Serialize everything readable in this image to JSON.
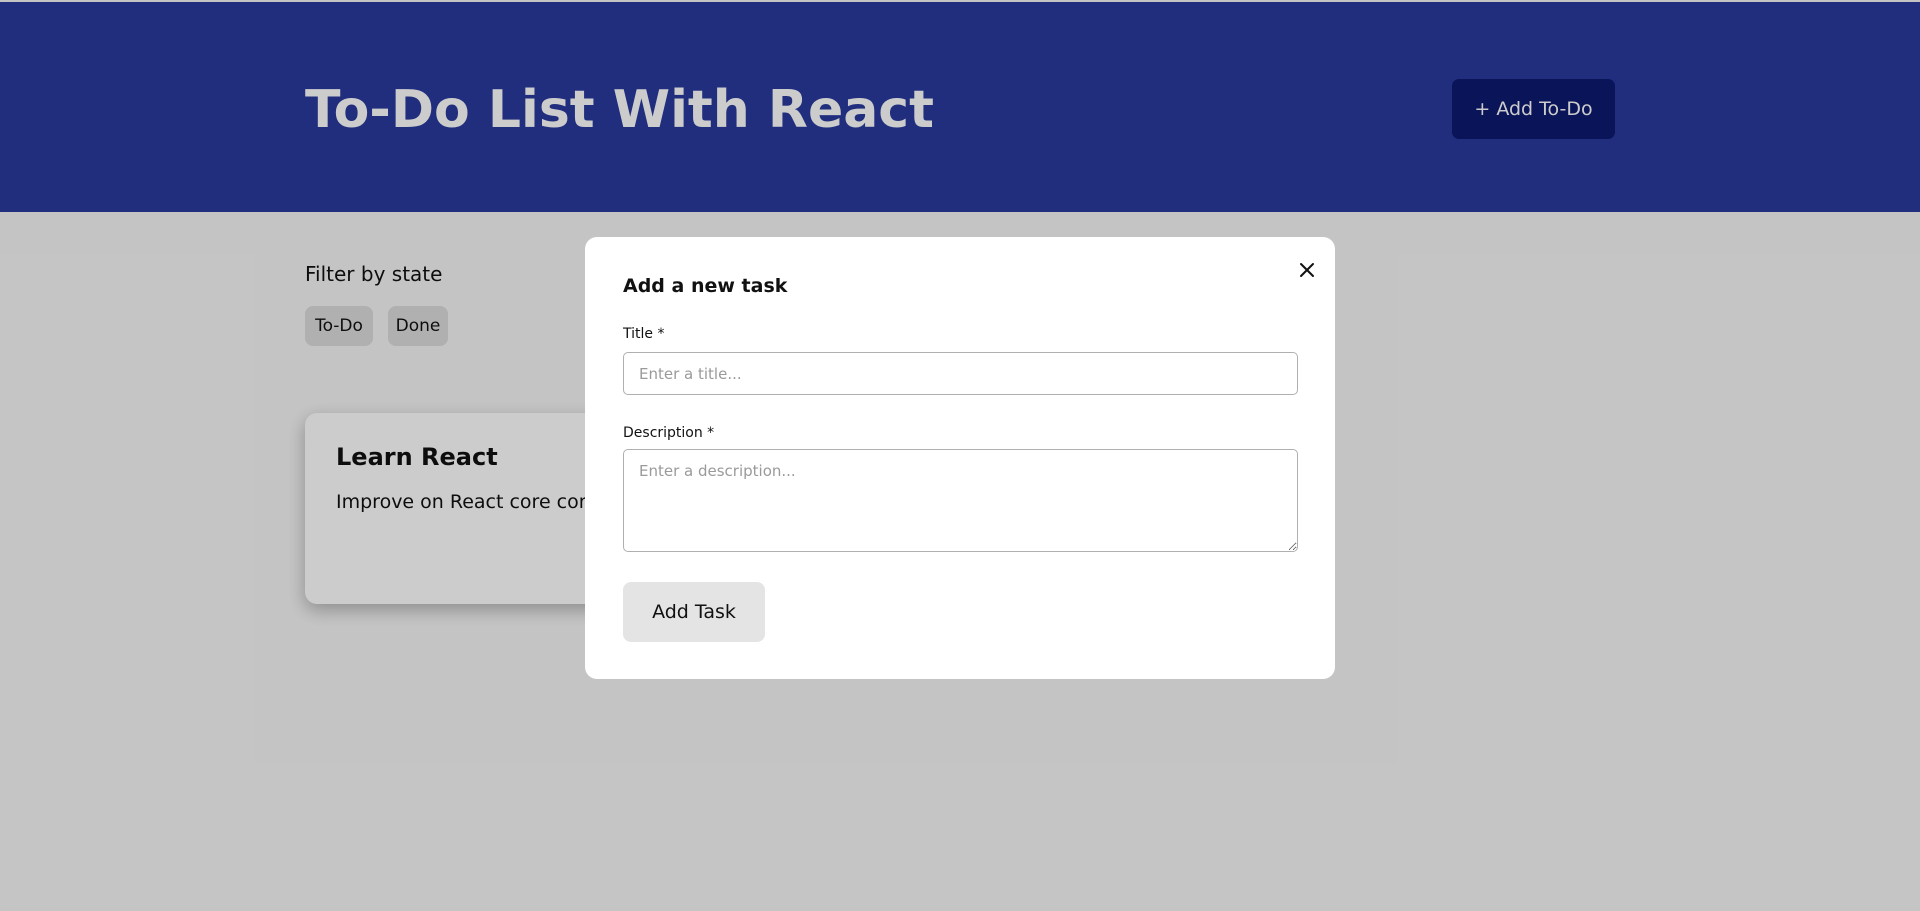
{
  "header": {
    "title": "To-Do List With React",
    "add_button_label": "+ Add To-Do"
  },
  "filter": {
    "label": "Filter by state",
    "chips": [
      {
        "label": "To-Do"
      },
      {
        "label": "Done"
      }
    ]
  },
  "tasks": [
    {
      "title": "Learn React",
      "description": "Improve on React core con"
    }
  ],
  "modal": {
    "title": "Add a new task",
    "close_icon": "close-icon",
    "title_label": "Title *",
    "title_placeholder": "Enter a title...",
    "description_label": "Description *",
    "description_placeholder": "Enter a description...",
    "submit_label": "Add Task"
  },
  "colors": {
    "header_background": "#2a3a9e",
    "add_button_background": "#0d1a6e",
    "page_background": "#f6f6f6",
    "overlay": "rgba(0,0,0,0.2)"
  }
}
